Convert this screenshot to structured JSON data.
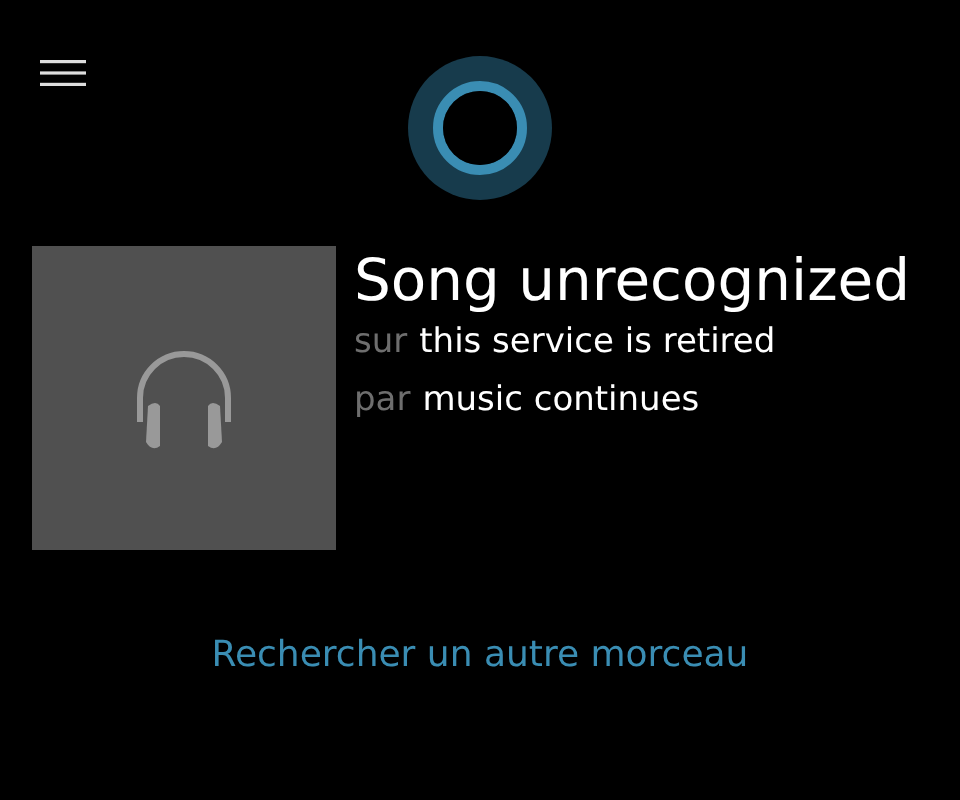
{
  "song": {
    "title": "Song unrecognized",
    "details": [
      {
        "label": "sur",
        "value": "this service is retired"
      },
      {
        "label": "par",
        "value": "music continues"
      }
    ]
  },
  "search_link": "Rechercher un autre morceau"
}
